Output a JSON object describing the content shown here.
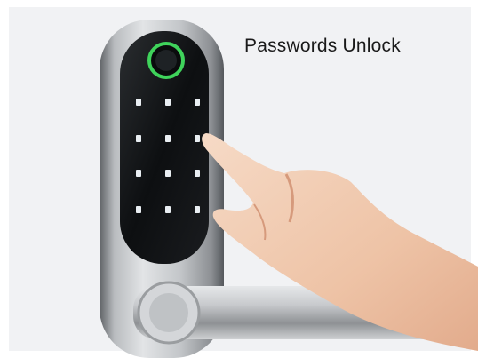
{
  "caption": "Passwords Unlock",
  "colors": {
    "background": "#f1f2f4",
    "lock_body": "#a9acaf",
    "keypad_glass": "#111315",
    "fingerprint_ring": "#3fd35b",
    "key_glow": "#e9eef2",
    "skin": "#f0c8ad"
  },
  "photo": {
    "subject": "smart-door-lock",
    "keypad_keys": [
      "",
      "",
      "",
      "",
      "",
      "",
      "",
      "",
      "",
      "",
      "",
      ""
    ]
  }
}
